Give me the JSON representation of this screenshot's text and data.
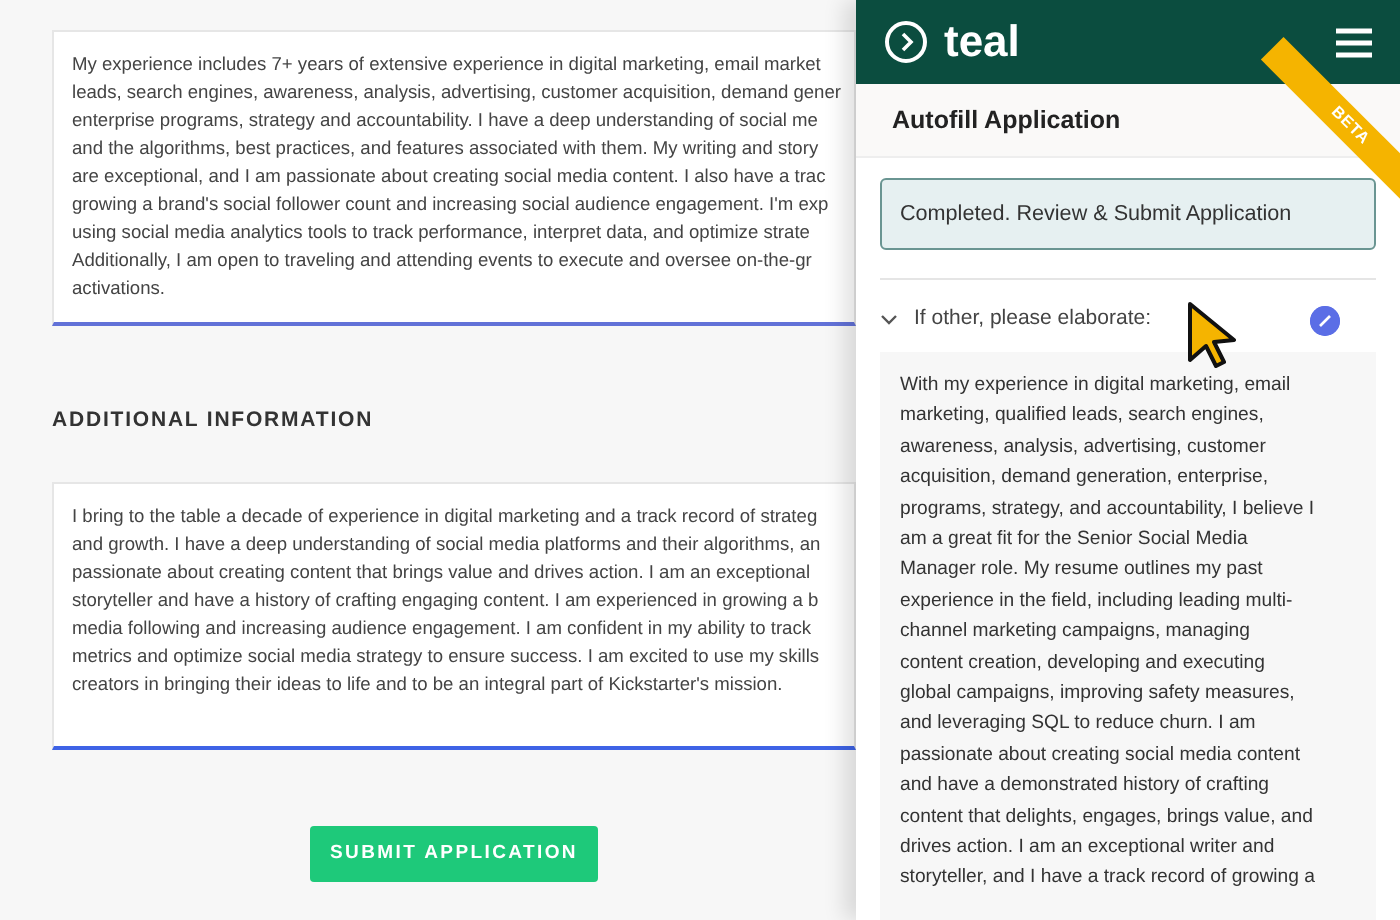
{
  "application_form": {
    "answer_1": {
      "lines": [
        "My experience includes 7+ years of extensive experience in digital marketing, email market",
        "leads, search engines, awareness, analysis, advertising, customer acquisition, demand gener",
        "enterprise programs, strategy and accountability. I have a deep understanding of social me",
        "and the algorithms, best practices, and features associated with them. My writing and story",
        "are exceptional, and I am passionate about creating social media content. I also have a trac",
        "growing a brand's social follower count and increasing social audience engagement. I'm exp",
        "using social media analytics tools to track performance, interpret data, and optimize strate",
        "Additionally, I am open to traveling and attending events to execute and oversee on-the-gr",
        "activations."
      ]
    },
    "section_heading": "ADDITIONAL INFORMATION",
    "answer_2": {
      "lines": [
        "I bring to the table a decade of experience in digital marketing and a track record of strateg",
        "and growth. I have a deep understanding of social media platforms and their algorithms, an",
        "passionate about creating content that brings value and drives action. I am an exceptional",
        "storyteller and have a history of crafting engaging content. I am experienced in growing a b",
        "media following and increasing audience engagement. I am confident in my ability to track",
        "metrics and optimize social media strategy to ensure success. I am excited to use my skills",
        "creators in bringing their ideas to life and to be an integral part of Kickstarter's mission."
      ]
    },
    "submit_button": "SUBMIT APPLICATION"
  },
  "teal_panel": {
    "logo_text": "teal",
    "title": "Autofill Application",
    "ribbon": "BETA",
    "status": "Completed. Review & Submit Application",
    "question": {
      "label": "If other, please elaborate:",
      "expanded": true,
      "answer_lines": [
        "With my experience in digital marketing, email",
        "marketing, qualified leads, search engines,",
        "awareness, analysis, advertising, customer",
        "acquisition, demand generation, enterprise,",
        "programs, strategy, and accountability, I believe I",
        "am a great fit for the Senior Social Media",
        "Manager role. My resume outlines my past",
        "experience in the field, including leading multi-",
        "channel marketing campaigns, managing",
        "content creation, developing and executing",
        "global campaigns, improving safety measures,",
        "and leveraging SQL to reduce churn. I am",
        "passionate about creating social media content",
        "and have a demonstrated history of crafting",
        "content that delights, engages, brings value, and",
        "drives action. I am an exceptional writer and",
        "storyteller, and I have a track record of growing a"
      ]
    }
  }
}
